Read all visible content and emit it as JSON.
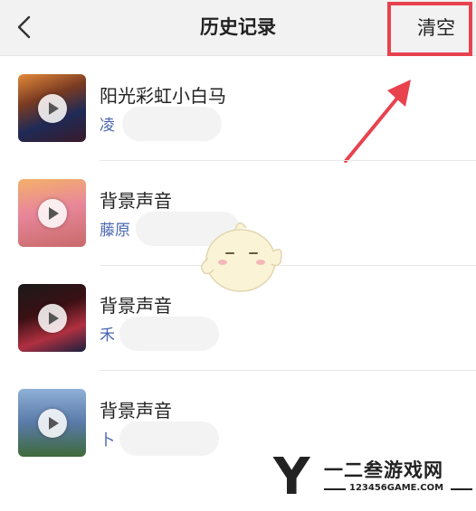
{
  "header": {
    "title": "历史记录",
    "clear_label": "清空",
    "back_icon": "chevron-left-icon"
  },
  "annotation": {
    "highlight_color": "#e8424f"
  },
  "history": [
    {
      "title": "阳光彩虹小白马",
      "artist": "凌"
    },
    {
      "title": "背景声音",
      "artist": "藤原"
    },
    {
      "title": "背景声音",
      "artist": "禾"
    },
    {
      "title": "背景声音",
      "artist": "卜"
    }
  ],
  "watermark": {
    "logo_letter": "Y",
    "name": "一二叁游戏网",
    "url": "123456GAME.COM"
  },
  "colors": {
    "artist_text": "#4a66b0",
    "header_bg": "#f2f2f2"
  }
}
